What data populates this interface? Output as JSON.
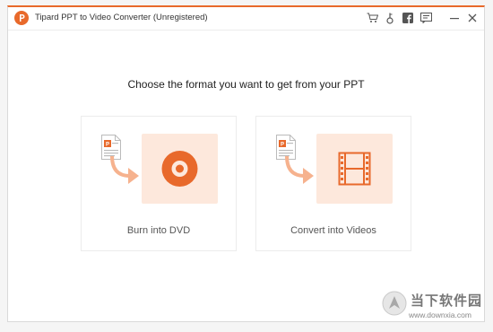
{
  "window": {
    "title": "Tipard PPT to Video Converter (Unregistered)",
    "accent": "#e8692b"
  },
  "toolbar": {
    "icons": [
      "cart-icon",
      "key-icon",
      "facebook-icon",
      "feedback-icon",
      "minimize-icon",
      "close-icon"
    ],
    "minimize_glyph": "—",
    "close_glyph": "✕"
  },
  "main": {
    "prompt": "Choose the format you want to get from your PPT",
    "options": [
      {
        "label": "Burn into DVD",
        "icon": "dvd-icon"
      },
      {
        "label": "Convert into Videos",
        "icon": "film-icon"
      }
    ]
  },
  "watermark": {
    "cn_text": "当下软件园",
    "url": "www.downxia.com"
  }
}
